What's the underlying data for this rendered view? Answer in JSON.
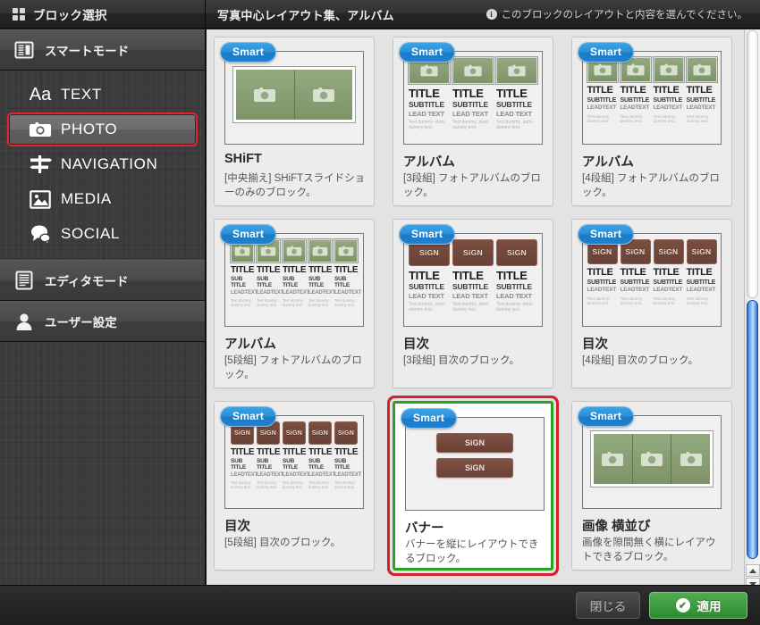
{
  "window": {
    "title": "ブロック選択",
    "grid_icon": "grid-icon"
  },
  "panel": {
    "title": "写真中心レイアウト集、アルバム",
    "hint": "このブロックのレイアウトと内容を選んでください。",
    "hint_icon": "info-icon",
    "info_glyph": "i"
  },
  "sidebar": {
    "sections": [
      {
        "label": "スマートモード",
        "icon": "smart-mode-icon"
      },
      {
        "label": "エディタモード",
        "icon": "editor-mode-icon"
      },
      {
        "label": "ユーザー設定",
        "icon": "user-settings-icon"
      }
    ],
    "items": [
      {
        "label": "TEXT",
        "icon": "text-icon",
        "selected": false
      },
      {
        "label": "PHOTO",
        "icon": "camera-icon",
        "selected": true
      },
      {
        "label": "NAVIGATION",
        "icon": "navigation-icon",
        "selected": false
      },
      {
        "label": "MEDIA",
        "icon": "media-image-icon",
        "selected": false
      },
      {
        "label": "SOCIAL",
        "icon": "social-chat-icon",
        "selected": false
      }
    ]
  },
  "cards": [
    {
      "badge": "Smart",
      "title": "SHiFT",
      "desc": "[中央揃え] SHiFTスライドショーのみのブロック。",
      "preview": "strip",
      "cells": 2,
      "selected": false
    },
    {
      "badge": "Smart",
      "title": "アルバム",
      "desc": "[3段組] フォトアルバムのブロック。",
      "preview": "album",
      "cells": 3,
      "thumb": "photo",
      "sample": {
        "title": "TITLE",
        "subtitle": "SUBTITLE",
        "lead": "LEAD TEXT",
        "body": "Text dummy .dumi dummy text."
      },
      "selected": false
    },
    {
      "badge": "Smart",
      "title": "アルバム",
      "desc": "[4段組] フォトアルバムのブロック。",
      "preview": "album",
      "cells": 4,
      "thumb": "photo",
      "sample": {
        "title": "TITLE",
        "subtitle": "SUBTITLE",
        "lead": "LEADTEXT",
        "body": "Text dummy dummy text."
      },
      "selected": false
    },
    {
      "badge": "Smart",
      "title": "アルバム",
      "desc": "[5段組] フォトアルバムのブロック。",
      "preview": "album",
      "cells": 5,
      "thumb": "photo",
      "sample": {
        "title": "TITLE",
        "subtitle": "SUB TITLE",
        "lead": "LEADTEXT",
        "body": "Text dummy dummy text."
      },
      "selected": false
    },
    {
      "badge": "Smart",
      "title": "目次",
      "desc": "[3段組] 目次のブロック。",
      "preview": "album",
      "cells": 3,
      "thumb": "sign",
      "sign_label": "SiGN",
      "sample": {
        "title": "TITLE",
        "subtitle": "SUBTITLE",
        "lead": "LEAD TEXT",
        "body": "Text dummy .dumi dummy text."
      },
      "selected": false
    },
    {
      "badge": "Smart",
      "title": "目次",
      "desc": "[4段組] 目次のブロック。",
      "preview": "album",
      "cells": 4,
      "thumb": "sign",
      "sign_label": "SiGN",
      "sample": {
        "title": "TITLE",
        "subtitle": "SUBTITLE",
        "lead": "LEADTEXT",
        "body": "Text dummy dummy text."
      },
      "selected": false
    },
    {
      "badge": "Smart",
      "title": "目次",
      "desc": "[5段組] 目次のブロック。",
      "preview": "album",
      "cells": 5,
      "thumb": "sign",
      "sign_label": "SiGN",
      "sample": {
        "title": "TITLE",
        "subtitle": "SUB TITLE",
        "lead": "LEADTEXT",
        "body": "Text dummy dummy text."
      },
      "selected": false
    },
    {
      "badge": "Smart",
      "title": "バナー",
      "desc": "バナーを縦にレイアウトできるブロック。",
      "preview": "banner",
      "banners": [
        "SiGN",
        "SiGN"
      ],
      "selected": true
    },
    {
      "badge": "Smart",
      "title": "画像 横並び",
      "desc": "画像を隙間無く横にレイアウトできるブロック。",
      "preview": "strip",
      "cells": 3,
      "selected": false
    }
  ],
  "scrollbar": {
    "up_arrow": "scroll-up-arrow",
    "down_arrow": "scroll-down-arrow"
  },
  "footer": {
    "close_label": "閉じる",
    "apply_label": "適用",
    "apply_icon": "check-circle-icon",
    "check_glyph": "✔"
  },
  "colors": {
    "accent_blue": "#2a8fd8",
    "apply_green": "#2c8a2f",
    "selection_red": "#d4222b",
    "selection_green": "#25a425",
    "photo_green": "#7e9468",
    "sign_brown": "#6b4136"
  }
}
